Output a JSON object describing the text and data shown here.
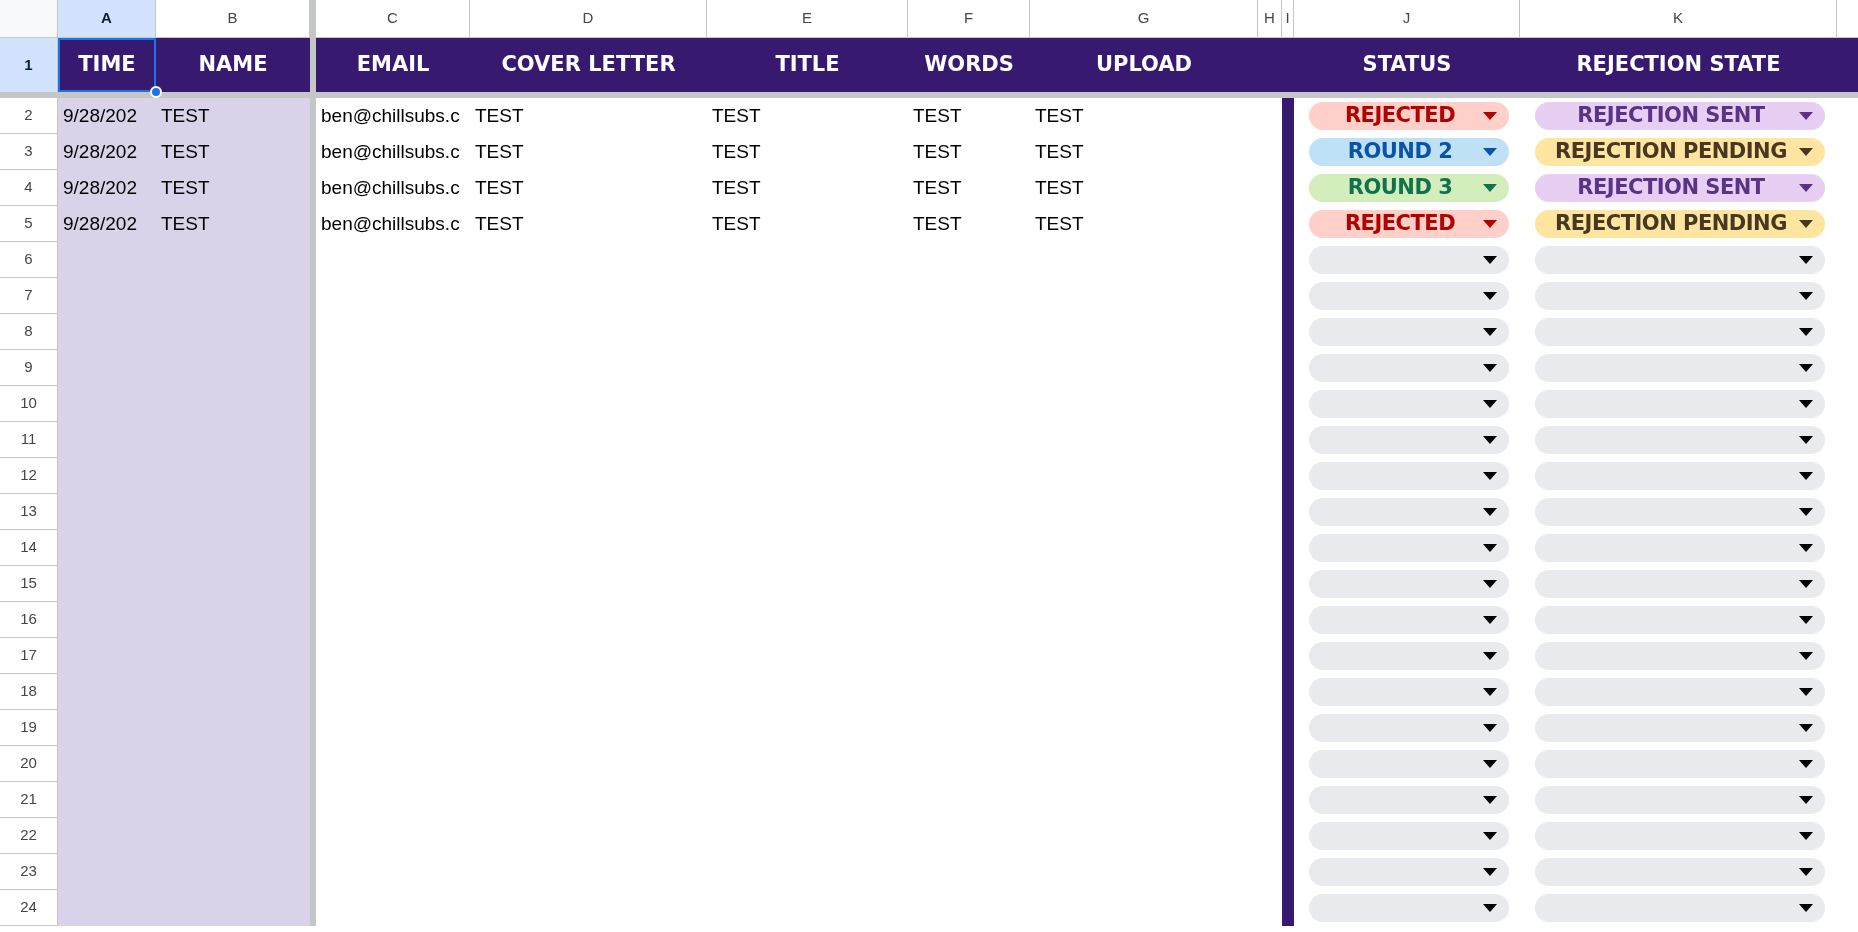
{
  "column_headers": [
    {
      "label": "A",
      "selected": true
    },
    {
      "label": "B",
      "selected": false
    },
    {
      "label": "C",
      "selected": false
    },
    {
      "label": "D",
      "selected": false
    },
    {
      "label": "E",
      "selected": false
    },
    {
      "label": "F",
      "selected": false
    },
    {
      "label": "G",
      "selected": false
    },
    {
      "label": "H",
      "selected": false
    },
    {
      "label": "I",
      "selected": false
    },
    {
      "label": "J",
      "selected": false
    },
    {
      "label": "K",
      "selected": false
    }
  ],
  "header_row": {
    "number": "1",
    "selected": true,
    "cells": [
      {
        "text": "TIME",
        "selected": true
      },
      {
        "text": "NAME",
        "selected": false
      },
      {
        "text": "EMAIL",
        "selected": false
      },
      {
        "text": "COVER LETTER",
        "selected": false
      },
      {
        "text": "TITLE",
        "selected": false
      },
      {
        "text": "WORDS",
        "selected": false
      },
      {
        "text": "UPLOAD",
        "selected": false
      },
      {
        "text": "STATUS",
        "selected": false
      },
      {
        "text": "REJECTION STATE",
        "selected": false
      }
    ]
  },
  "rows": [
    {
      "number": "2",
      "time": "9/28/202",
      "name": "TEST",
      "email": "ben@chillsubs.c",
      "cover_letter": "TEST",
      "title": "TEST",
      "words": "TEST",
      "upload": "TEST",
      "status": {
        "value": "REJECTED",
        "color": "#ffcfc9"
      },
      "rejection_state": {
        "value": "REJECTION SENT",
        "color": "#e6cff2"
      }
    },
    {
      "number": "3",
      "time": "9/28/202",
      "name": "TEST",
      "email": "ben@chillsubs.c",
      "cover_letter": "TEST",
      "title": "TEST",
      "words": "TEST",
      "upload": "TEST",
      "status": {
        "value": "ROUND 2",
        "color": "#bfe1f6"
      },
      "rejection_state": {
        "value": "REJECTION PENDING",
        "color": "#ffe5a0"
      }
    },
    {
      "number": "4",
      "time": "9/28/202",
      "name": "TEST",
      "email": "ben@chillsubs.c",
      "cover_letter": "TEST",
      "title": "TEST",
      "words": "TEST",
      "upload": "TEST",
      "status": {
        "value": "ROUND 3",
        "color": "#d4edbc"
      },
      "rejection_state": {
        "value": "REJECTION SENT",
        "color": "#e6cff2"
      }
    },
    {
      "number": "5",
      "time": "9/28/202",
      "name": "TEST",
      "email": "ben@chillsubs.c",
      "cover_letter": "TEST",
      "title": "TEST",
      "words": "TEST",
      "upload": "TEST",
      "status": {
        "value": "REJECTED",
        "color": "#ffcfc9"
      },
      "rejection_state": {
        "value": "REJECTION PENDING",
        "color": "#ffe5a0"
      }
    },
    {
      "number": "6",
      "status": {
        "color": "#e8eaed"
      },
      "rejection_state": {
        "color": "#e8eaed"
      }
    },
    {
      "number": "7",
      "status": {
        "color": "#e8eaed"
      },
      "rejection_state": {
        "color": "#e8eaed"
      }
    },
    {
      "number": "8",
      "status": {
        "color": "#e8eaed"
      },
      "rejection_state": {
        "color": "#e8eaed"
      }
    },
    {
      "number": "9",
      "status": {
        "color": "#e8eaed"
      },
      "rejection_state": {
        "color": "#e8eaed"
      }
    },
    {
      "number": "10",
      "status": {
        "color": "#e8eaed"
      },
      "rejection_state": {
        "color": "#e8eaed"
      }
    },
    {
      "number": "11",
      "status": {
        "color": "#e8eaed"
      },
      "rejection_state": {
        "color": "#e8eaed"
      }
    },
    {
      "number": "12",
      "status": {
        "color": "#e8eaed"
      },
      "rejection_state": {
        "color": "#e8eaed"
      }
    },
    {
      "number": "13",
      "status": {
        "color": "#e8eaed"
      },
      "rejection_state": {
        "color": "#e8eaed"
      }
    },
    {
      "number": "14",
      "status": {
        "color": "#e8eaed"
      },
      "rejection_state": {
        "color": "#e8eaed"
      }
    },
    {
      "number": "15",
      "status": {
        "color": "#e8eaed"
      },
      "rejection_state": {
        "color": "#e8eaed"
      }
    },
    {
      "number": "16",
      "status": {
        "color": "#e8eaed"
      },
      "rejection_state": {
        "color": "#e8eaed"
      }
    },
    {
      "number": "17",
      "status": {
        "color": "#e8eaed"
      },
      "rejection_state": {
        "color": "#e8eaed"
      }
    },
    {
      "number": "18",
      "status": {
        "color": "#e8eaed"
      },
      "rejection_state": {
        "color": "#e8eaed"
      }
    },
    {
      "number": "19",
      "status": {
        "color": "#e8eaed"
      },
      "rejection_state": {
        "color": "#e8eaed"
      }
    },
    {
      "number": "20",
      "status": {
        "color": "#e8eaed"
      },
      "rejection_state": {
        "color": "#e8eaed"
      }
    },
    {
      "number": "21",
      "status": {
        "color": "#e8eaed"
      },
      "rejection_state": {
        "color": "#e8eaed"
      }
    },
    {
      "number": "22",
      "status": {
        "color": "#e8eaed"
      },
      "rejection_state": {
        "color": "#e8eaed"
      }
    },
    {
      "number": "23",
      "status": {
        "color": "#e8eaed"
      },
      "rejection_state": {
        "color": "#e8eaed"
      }
    },
    {
      "number": "24",
      "status": {
        "color": "#e8eaed"
      },
      "rejection_state": {
        "color": "#e8eaed"
      }
    }
  ]
}
